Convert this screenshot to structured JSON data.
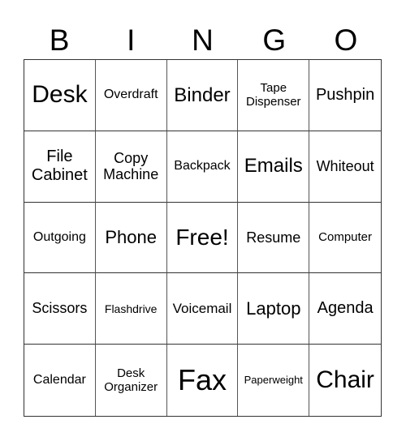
{
  "header": [
    "B",
    "I",
    "N",
    "G",
    "O"
  ],
  "cells": [
    "Desk",
    "Overdraft",
    "Binder",
    "Tape Dispenser",
    "Pushpin",
    "File Cabinet",
    "Copy Machine",
    "Backpack",
    "Emails",
    "Whiteout",
    "Outgoing",
    "Phone",
    "Free!",
    "Resume",
    "Computer",
    "Scissors",
    "Flashdrive",
    "Voicemail",
    "Laptop",
    "Agenda",
    "Calendar",
    "Desk Organizer",
    "Fax",
    "Paperweight",
    "Chair"
  ]
}
